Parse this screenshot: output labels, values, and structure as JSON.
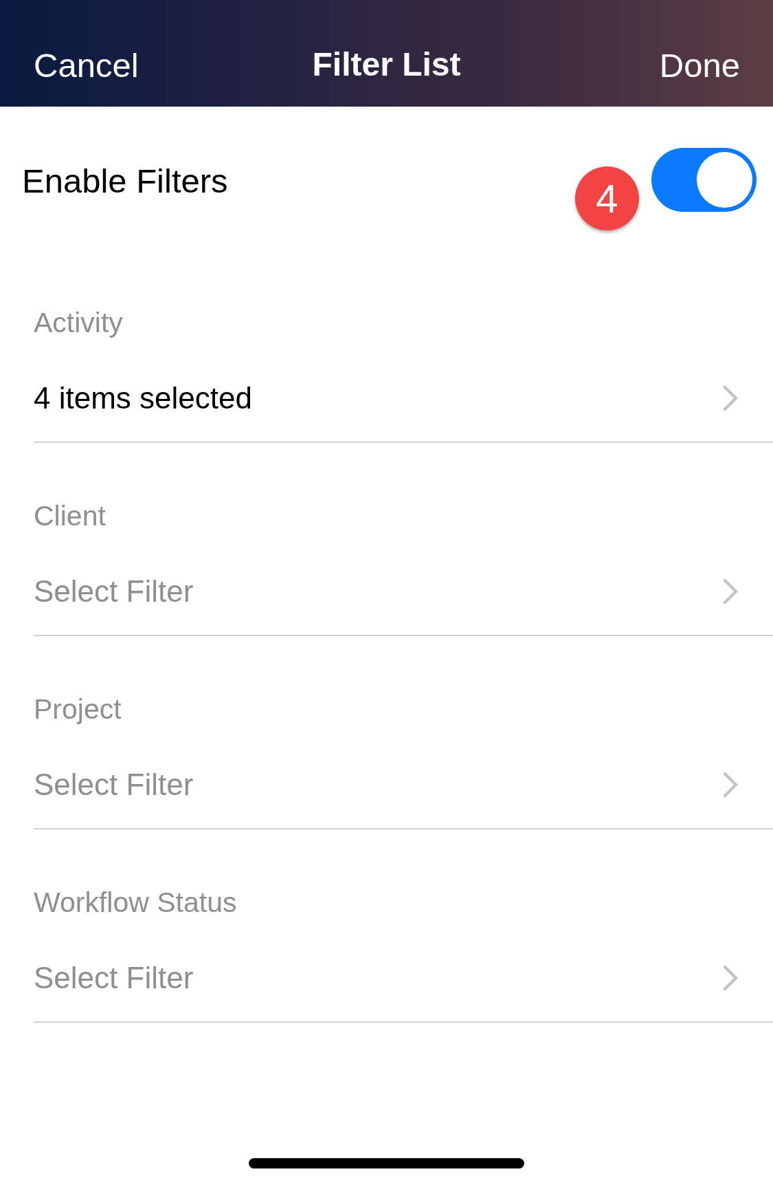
{
  "nav_bar": {
    "cancel": "Cancel",
    "title": "Filter List",
    "done": "Done"
  },
  "enable_filters": {
    "label": "Enable Filters",
    "on": true,
    "badge": "4"
  },
  "filters": [
    {
      "label": "Activity",
      "value": "4 items selected"
    },
    {
      "label": "Client",
      "placeholder": "Select Filter"
    },
    {
      "label": "Project",
      "placeholder": "Select Filter"
    },
    {
      "label": "Workflow Status",
      "placeholder": "Select Filter"
    }
  ]
}
